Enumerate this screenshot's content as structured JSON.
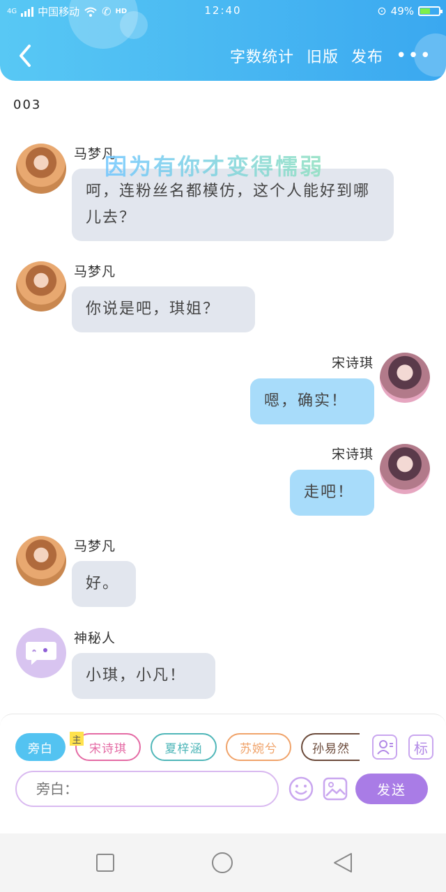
{
  "status_bar": {
    "network": "4G",
    "carrier": "中国移动",
    "hd": "HD",
    "time": "12:40",
    "battery": "49%",
    "battery_level": 0.49
  },
  "header": {
    "actions": [
      "字数统计",
      "旧版",
      "发布"
    ],
    "more": "•••"
  },
  "chapter_label": "003",
  "watermark": "因为有你才变得懦弱",
  "messages": [
    {
      "speaker": "马梦凡",
      "text": "呵，连粉丝名都模仿，这个人能好到哪儿去？"
    },
    {
      "speaker": "马梦凡",
      "text": "你说是吧，琪姐？"
    },
    {
      "speaker": "宋诗琪",
      "text": "嗯，确实！"
    },
    {
      "speaker": "宋诗琪",
      "text": "走吧！"
    },
    {
      "speaker": "马梦凡",
      "text": "好。"
    },
    {
      "speaker": "神秘人",
      "text": "小琪，小凡！"
    }
  ],
  "role_bar": {
    "narrator": "旁白",
    "main_tag": "主",
    "roles": [
      "宋诗琪",
      "夏梓涵",
      "苏婉兮",
      "孙易然"
    ],
    "label_button": "标"
  },
  "composer": {
    "placeholder": "旁白：",
    "send": "发送"
  },
  "colors": {
    "header_start": "#58c8f4",
    "header_end": "#3aa8f0",
    "bubble_left": "#e2e6ee",
    "bubble_right": "#a8dcfa",
    "send_button": "#a97ce6",
    "narrator_chip": "#53c3f1",
    "role_songshiqi": "#e46aa4",
    "role_xiazihan": "#4eb6b8",
    "role_suwanxi": "#f0a36a",
    "role_sunyiran": "#6b4a3a"
  }
}
